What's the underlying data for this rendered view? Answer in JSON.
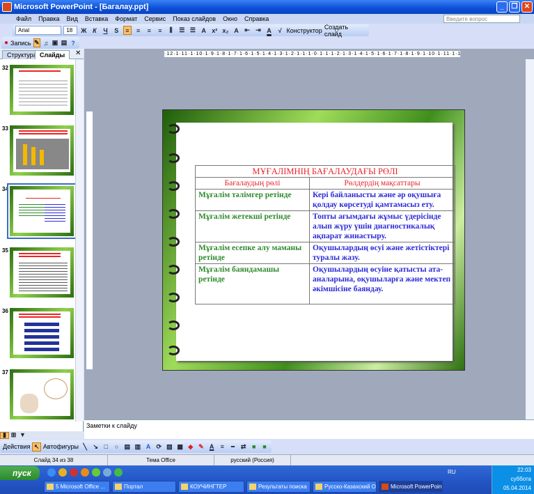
{
  "window": {
    "title": "Microsoft PowerPoint - [Багалау.ppt]"
  },
  "menu": [
    "Файл",
    "Правка",
    "Вид",
    "Вставка",
    "Формат",
    "Сервис",
    "Показ слайдов",
    "Окно",
    "Справка"
  ],
  "ask_placeholder": "Введите вопрос",
  "format_toolbar": {
    "font": "Arial",
    "size": "18",
    "bold": "Ж",
    "italic": "К",
    "underline": "Ч",
    "shadow": "S",
    "designer": "Конструктор",
    "new_slide": "Создать слайд"
  },
  "record_toolbar": {
    "record": "Запись"
  },
  "panel_tabs": {
    "outline": "Структура",
    "slides": "Слайды"
  },
  "thumbnails": [
    {
      "num": "32"
    },
    {
      "num": "33"
    },
    {
      "num": "34"
    },
    {
      "num": "35"
    },
    {
      "num": "36"
    },
    {
      "num": "37"
    }
  ],
  "ruler": "·12·1·11·1·10·1·9·1·8·1·7·1·6·1·5·1·4·1·3·1·2·1·1·1·0·1·1·1·2·1·3·1·4·1·5·1·6·1·7·1·8·1·9·1·10·1·11·1·12·",
  "slide": {
    "title": "МҰҒАЛІМНІҢ БАҒАЛАУДАҒЫ РӨЛІ",
    "headers": [
      "Бағалаудың рөлі",
      "Рөлдердің мақсаттары"
    ],
    "rows": [
      {
        "role": "Мұғалім тәлімгер ретінде",
        "goal": "Кері байланысты және әр оқушыға қолдау көрсетуді қамтамасыз ету."
      },
      {
        "role": "Мұғалім жетекші ретінде",
        "goal": "Топты ағымдағы жұмыс үдерісінде алып жүру үшін диагностикалық ақпарат жинастыру."
      },
      {
        "role": "Мұғалім есепке алу маманы ретінде",
        "goal": "Оқушылардың өсуі және жетістіктері туралы жазу."
      },
      {
        "role": "Мұғалім баяндамашы ретінде",
        "goal": "Оқушылардың өсуіне қатысты ата-аналарына, оқушыларға және мектеп әкімшісіне баяндау."
      }
    ]
  },
  "notes_placeholder": "Заметки к слайду",
  "draw_toolbar": {
    "actions": "Действия",
    "autoshapes": "Автофигуры"
  },
  "status": {
    "slide": "Слайд 34 из 38",
    "theme": "Тема Office",
    "language": "русский (Россия)"
  },
  "taskbar": {
    "start": "пуск",
    "tasks": [
      "5 Microsoft Office ...",
      "Портал",
      "КОУЧИНГТЕР",
      "Результаты поиска",
      "Русско-Казахский О...",
      "Microsoft PowerPoint ..."
    ],
    "lang": "RU",
    "time": "22:03",
    "day": "суббота",
    "date": "05.04.2014"
  }
}
